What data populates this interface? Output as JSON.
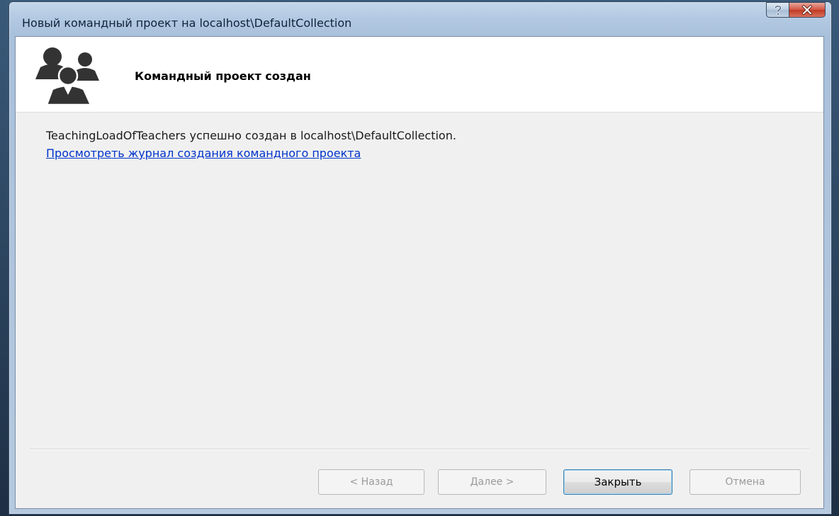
{
  "window": {
    "title": "Новый командный проект на localhost\\DefaultCollection"
  },
  "header": {
    "icon": "team-people-icon",
    "title": "Командный проект создан"
  },
  "content": {
    "message": "TeachingLoadOfTeachers успешно создан в localhost\\DefaultCollection.",
    "log_link": "Просмотреть журнал создания командного проекта"
  },
  "buttons": {
    "back": "< Назад",
    "next": "Далее >",
    "close": "Закрыть",
    "cancel": "Отмена"
  },
  "colors": {
    "link": "#0033cc",
    "close_button_border": "#3c7fb1",
    "caption_close": "#c13a22"
  }
}
